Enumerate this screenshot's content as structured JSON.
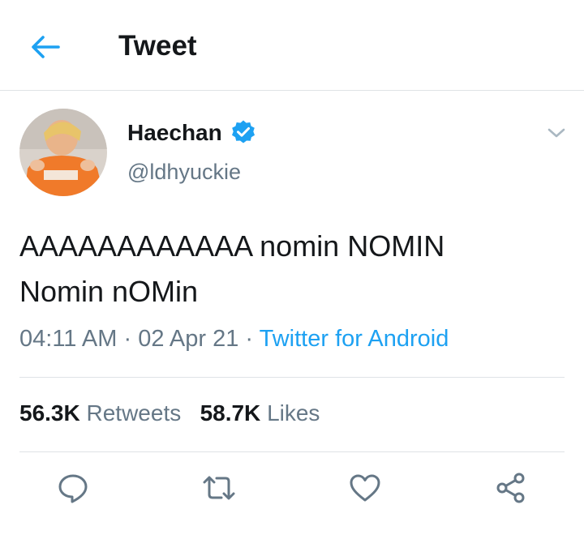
{
  "header": {
    "back_icon": "arrow-left-icon",
    "title": "Tweet"
  },
  "tweet": {
    "author_name": "Haechan",
    "verified": true,
    "handle": "@ldhyuckie",
    "text": "AAAAAAAAAAAA nomin NOMIN\nNomin nOMin",
    "time": "04:11 AM",
    "date": "02 Apr 21",
    "separator": "·",
    "source": "Twitter for Android"
  },
  "stats": {
    "retweets_count": "56.3K",
    "retweets_label": "Retweets",
    "likes_count": "58.7K",
    "likes_label": "Likes"
  },
  "actions": [
    {
      "icon": "reply-icon"
    },
    {
      "icon": "retweet-icon"
    },
    {
      "icon": "like-icon"
    },
    {
      "icon": "share-icon"
    }
  ],
  "colors": {
    "accent": "#1da1f2",
    "secondary_text": "#657786",
    "divider": "#dfe3e6"
  }
}
